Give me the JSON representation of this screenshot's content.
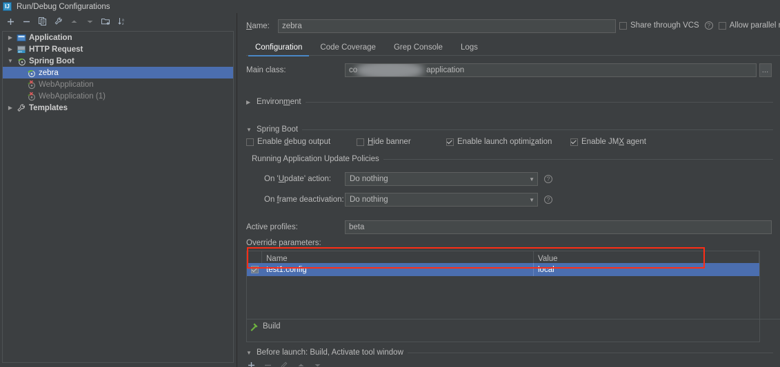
{
  "window": {
    "title": "Run/Debug Configurations",
    "app_icon": "intellij-idea-icon",
    "icon_text": "IJ"
  },
  "colors": {
    "background": "#3C3F41",
    "field_background": "#45494A",
    "selection_blue": "#4B6EAF",
    "tab_accent": "#4A88C7",
    "annotation_red": "#FF2D16",
    "text": "#BBBBBB",
    "border": "#4E5254"
  },
  "tree_toolbar": {
    "buttons": [
      {
        "name": "add-configuration-button",
        "glyph": "+"
      },
      {
        "name": "remove-configuration-button",
        "glyph": "−"
      },
      {
        "name": "copy-configuration-button",
        "glyph": "copy-icon"
      },
      {
        "name": "edit-templates-button",
        "glyph": "wrench-icon"
      },
      {
        "name": "move-up-button",
        "glyph": "▲"
      },
      {
        "name": "move-down-button",
        "glyph": "▼"
      },
      {
        "name": "new-folder-button",
        "glyph": "folder-add-icon"
      },
      {
        "name": "sort-configurations-button",
        "glyph": "sort-az-icon"
      }
    ]
  },
  "tree": {
    "items": [
      {
        "label": "Application",
        "icon": "application-icon",
        "expanded": false,
        "level": 0,
        "bold": true,
        "selected": false,
        "invalid": false
      },
      {
        "label": "HTTP Request",
        "icon": "http-request-icon",
        "expanded": false,
        "level": 0,
        "bold": true,
        "selected": false,
        "invalid": false
      },
      {
        "label": "Spring Boot",
        "icon": "spring-boot-icon",
        "expanded": true,
        "level": 0,
        "bold": true,
        "selected": false,
        "invalid": false
      },
      {
        "label": "zebra",
        "icon": "spring-boot-icon",
        "expanded": null,
        "level": 1,
        "bold": false,
        "selected": true,
        "invalid": false
      },
      {
        "label": "WebApplication",
        "icon": "spring-boot-invalid-icon",
        "expanded": null,
        "level": 1,
        "bold": false,
        "selected": false,
        "invalid": true
      },
      {
        "label": "WebApplication (1)",
        "icon": "spring-boot-invalid-icon",
        "expanded": null,
        "level": 1,
        "bold": false,
        "selected": false,
        "invalid": true
      },
      {
        "label": "Templates",
        "icon": "wrench-icon",
        "expanded": false,
        "level": 0,
        "bold": true,
        "selected": false,
        "invalid": false
      }
    ]
  },
  "form": {
    "name_label": "Name:",
    "name_value": "zebra",
    "share_vcs_label": "Share through VCS",
    "share_vcs_checked": false,
    "share_vcs_help": "?",
    "allow_parallel_label": "Allow parallel r",
    "allow_parallel_checked": false
  },
  "tabs": [
    {
      "label": "Configuration",
      "active": true
    },
    {
      "label": "Code Coverage",
      "active": false
    },
    {
      "label": "Grep Console",
      "active": false
    },
    {
      "label": "Logs",
      "active": false
    }
  ],
  "configuration": {
    "main_class_label": "Main class:",
    "main_class_value_prefix": "co",
    "main_class_value_suffix": "application",
    "browse_button_label": "…",
    "environment_section": {
      "label": "Environment",
      "expanded": false
    },
    "spring_boot_section": {
      "label": "Spring Boot",
      "expanded": true
    },
    "spring_boot_checkboxes": [
      {
        "label": "Enable debug output",
        "checked": false,
        "mnemonic": "d"
      },
      {
        "label": "Hide banner",
        "checked": false,
        "mnemonic": "H"
      },
      {
        "label": "Enable launch optimization",
        "checked": true,
        "mnemonic": "z"
      },
      {
        "label": "Enable JMX agent",
        "checked": true,
        "mnemonic": "X"
      }
    ],
    "update_policies": {
      "title": "Running Application Update Policies",
      "rows": [
        {
          "label": "On 'Update' action:",
          "value": "Do nothing",
          "help": "?"
        },
        {
          "label": "On frame deactivation:",
          "value": "Do nothing",
          "help": "?"
        }
      ]
    },
    "active_profiles_label": "Active profiles:",
    "active_profiles_value": "beta",
    "override_parameters_label": "Override parameters:",
    "override_table": {
      "columns": [
        "Name",
        "Value"
      ],
      "rows": [
        {
          "enabled": true,
          "name": "test1.config",
          "value": "local",
          "selected": true
        }
      ],
      "side_buttons": [
        {
          "name": "add-parameter-button",
          "glyph": "+"
        },
        {
          "name": "remove-parameter-button",
          "glyph": "−"
        },
        {
          "name": "move-parameter-up-button",
          "glyph": "▲"
        },
        {
          "name": "move-parameter-down-button",
          "glyph": "▼"
        }
      ]
    }
  },
  "before_launch": {
    "title": "Before launch: Build, Activate tool window",
    "expanded": true,
    "toolbar": [
      {
        "name": "add-task-button",
        "glyph": "+",
        "enabled": true
      },
      {
        "name": "remove-task-button",
        "glyph": "−",
        "enabled": false
      },
      {
        "name": "edit-task-button",
        "glyph": "pencil-icon",
        "enabled": false
      },
      {
        "name": "move-task-up-button",
        "glyph": "▲",
        "enabled": false
      },
      {
        "name": "move-task-down-button",
        "glyph": "▼",
        "enabled": false
      }
    ],
    "items": [
      {
        "label": "Build",
        "icon": "build-hammer-icon"
      }
    ]
  }
}
